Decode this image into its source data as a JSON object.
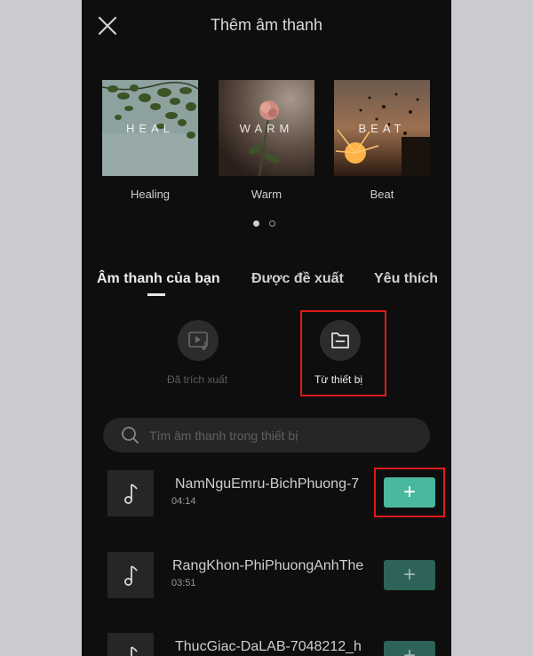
{
  "header": {
    "title": "Thêm âm thanh"
  },
  "colors": {
    "accent": "#4ab89e",
    "accent_dim": "#2d6358",
    "highlight": "#e01a1a",
    "background": "#0e0e0e"
  },
  "categories": [
    {
      "label": "Healing",
      "cover_text": "HEAL"
    },
    {
      "label": "Warm",
      "cover_text": "WARM"
    },
    {
      "label": "Beat",
      "cover_text": "BEAT"
    }
  ],
  "carousel": {
    "pages": 2,
    "active_page": 1
  },
  "tabs": [
    {
      "label": "Âm thanh của bạn",
      "active": true
    },
    {
      "label": "Được đề xuất",
      "active": false
    },
    {
      "label": "Yêu thích",
      "active": false
    }
  ],
  "sources": [
    {
      "label": "Đã trích xuất",
      "icon": "video-music-icon",
      "enabled": false
    },
    {
      "label": "Từ thiết bị",
      "icon": "folder-icon",
      "enabled": true
    }
  ],
  "search": {
    "placeholder": "Tìm âm thanh trong thiết bị"
  },
  "tracks": [
    {
      "title": "NamNguEmru-BichPhuong-7",
      "duration": "04:14",
      "add_label": "+",
      "icon": "music-note-icon"
    },
    {
      "title": "RangKhon-PhiPhuongAnhThe",
      "duration": "03:51",
      "add_label": "+",
      "icon": "music-note-icon"
    },
    {
      "title": "ThucGiac-DaLAB-7048212_h",
      "duration": "",
      "add_label": "+",
      "icon": "music-note-icon"
    }
  ]
}
